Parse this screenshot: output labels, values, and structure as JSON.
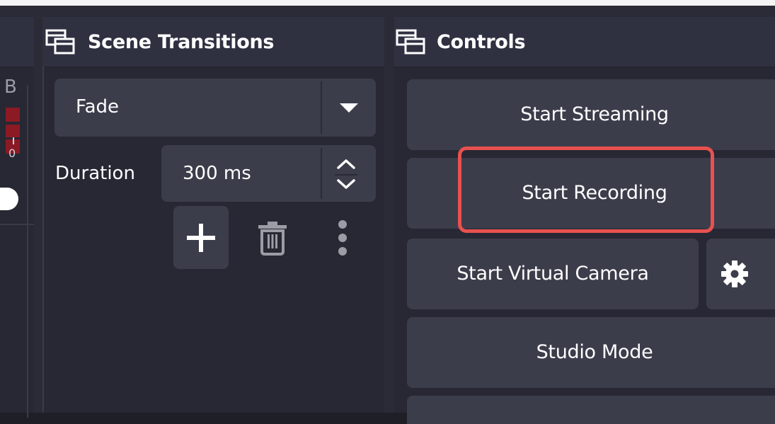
{
  "left_panel": {
    "meter_label": "B",
    "meter_tick": "0"
  },
  "scene_transitions": {
    "title": "Scene Transitions",
    "transition_value": "Fade",
    "duration_label": "Duration",
    "duration_value": "300 ms"
  },
  "controls": {
    "title": "Controls",
    "start_streaming": "Start Streaming",
    "start_recording": "Start Recording",
    "start_virtual_camera": "Start Virtual Camera",
    "studio_mode": "Studio Mode"
  },
  "colors": {
    "background": "#1e1f27",
    "panel": "#272833",
    "button": "#3c3d4b",
    "highlight": "#e8514f",
    "meter_red": "#8b1a25"
  },
  "icons": {
    "dock_title": "dock-windows-icon",
    "add": "plus-icon",
    "remove": "trash-icon",
    "more": "kebab-menu-icon",
    "settings": "gear-icon",
    "dropdown": "caret-down-icon",
    "spin": "chevron-up-down-icon"
  }
}
